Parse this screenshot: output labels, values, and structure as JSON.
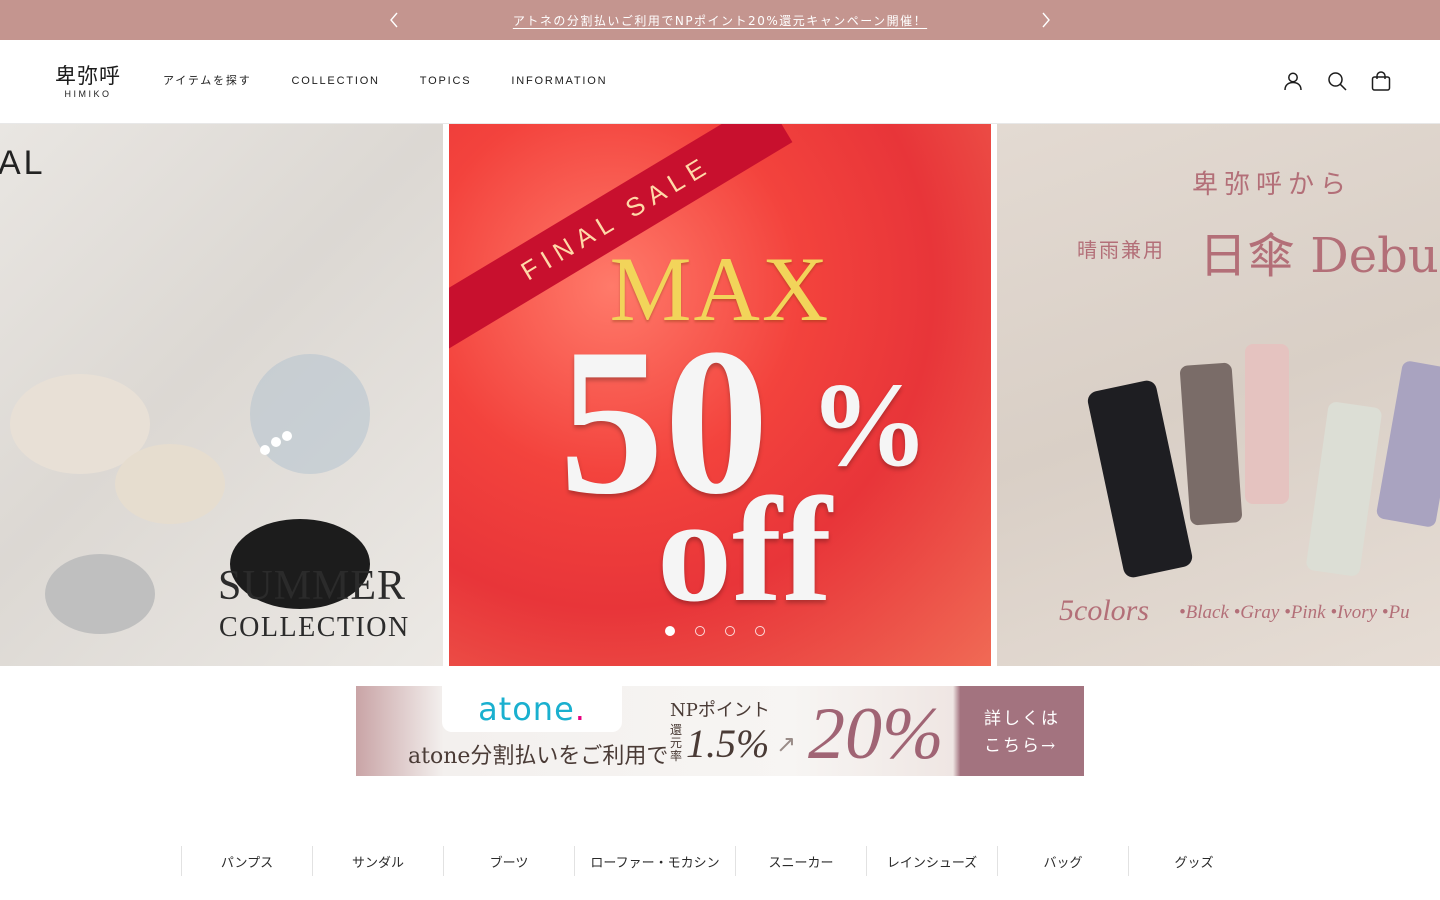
{
  "announcement": {
    "text": "アトネの分割払いご利用でNPポイント20%還元キャンペーン開催！"
  },
  "header": {
    "logo_jp": "卑弥呼",
    "logo_en": "HIMIKO",
    "nav": [
      "アイテムを探す",
      "COLLECTION",
      "TOPICS",
      "INFORMATION"
    ],
    "icons": [
      "account-icon",
      "search-icon",
      "cart-icon"
    ]
  },
  "hero": {
    "slide1": {
      "partial_text": "AL",
      "line1": "SUMMER",
      "line2": "COLLECTION"
    },
    "slide2": {
      "ribbon": "FINAL SALE",
      "max": "MAX",
      "number": "50",
      "percent": "%",
      "off": "off"
    },
    "slide3": {
      "from": "卑弥呼から",
      "rain": "晴雨兼用",
      "headline": "日傘 Debu",
      "colors": "5colors",
      "color_list": "•Black •Gray •Pink •Ivory •Pu"
    },
    "dots": 4,
    "active_dot": 1
  },
  "atone_banner": {
    "brand": "atone",
    "line1": "atone分割払いをご利用で",
    "np": "NPポイント",
    "rate_label": "還元率",
    "rate": "1.5%",
    "big": "20%",
    "more": "詳しくは\nこちら→"
  },
  "categories": [
    "パンプス",
    "サンダル",
    "ブーツ",
    "ローファー・モカシン",
    "スニーカー",
    "レインシューズ",
    "バッグ",
    "グッズ"
  ],
  "colors": {
    "announce_bg": "#c4958f",
    "accent_pink": "#b36f78",
    "sale_red": "#e83539"
  }
}
